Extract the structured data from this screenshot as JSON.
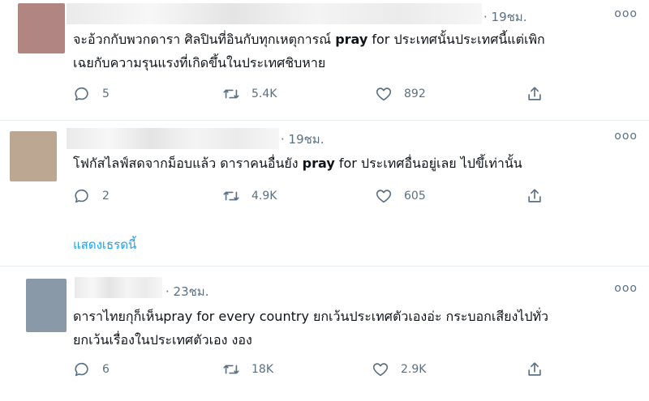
{
  "tweets": [
    {
      "time": "· 19ชม.",
      "more": "ooo",
      "text_before": "จะอ้วกกับพวกดารา ศิลปินที่อินกับทุกเหตุการณ์ ",
      "text_bold": "pray",
      "text_after": " for ประเทศนั้นประเทศนี้แต่เพิก\nเฉยกับความรุนแรงที่เกิดขึ้นในประเทศชิบหาย",
      "replies": "5",
      "retweets": "5.4K",
      "likes": "892",
      "avatar_color": "#b08582"
    },
    {
      "time": "· 19ชม.",
      "more": "ooo",
      "text_before": "โฟกัสไลฟ์สดจากม็อบแล้ว ดาราคนอื่นยัง ",
      "text_bold": "pray",
      "text_after": " for ประเทศอื่นอยู่เลย ไปขึ้เท่านั้น",
      "replies": "2",
      "retweets": "4.9K",
      "likes": "605",
      "show_thread": "แสดงเธรดนี้",
      "avatar_color": "#bca793"
    },
    {
      "time": "· 23ชม.",
      "more": "ooo",
      "text": "ดาราไทยกุก็เห็นpray for every country ยกเว้นประเทศตัวเองอ่ะ กระบอกเสียงไปทั่ว\nยกเว้นเรื่องในประเทศตัวเอง งอง",
      "replies": "6",
      "retweets": "18K",
      "likes": "2.9K",
      "avatar_color": "#8a99a8"
    }
  ],
  "icons": {
    "reply": "reply-icon",
    "retweet": "retweet-icon",
    "like": "like-icon",
    "share": "share-icon"
  },
  "colors": {
    "secondary_text": "#5b7083",
    "link": "#1da1f2",
    "divider": "#e6ecf0"
  }
}
